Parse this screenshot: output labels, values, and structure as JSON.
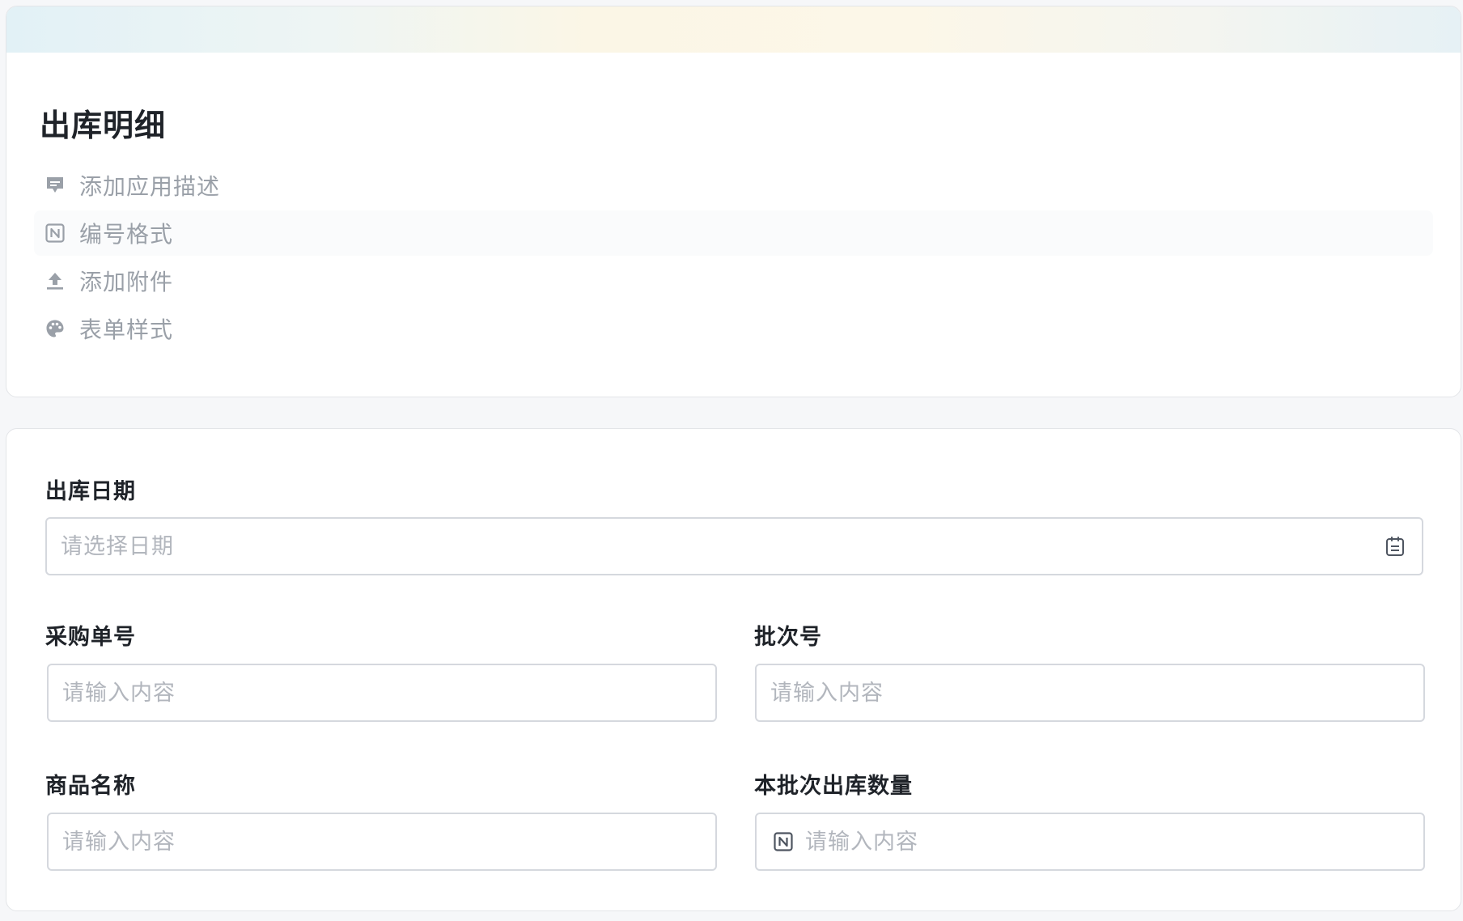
{
  "app": {
    "title": "出库明细",
    "meta": [
      {
        "label": "添加应用描述",
        "icon": "comment-icon"
      },
      {
        "label": "编号格式",
        "icon": "number-format-icon"
      },
      {
        "label": "添加附件",
        "icon": "upload-icon"
      },
      {
        "label": "表单样式",
        "icon": "palette-icon"
      }
    ]
  },
  "form": {
    "outbound_date": {
      "label": "出库日期",
      "placeholder": "请选择日期",
      "icon": "calendar-icon"
    },
    "purchase_no": {
      "label": "采购单号",
      "placeholder": "请输入内容"
    },
    "batch_no": {
      "label": "批次号",
      "placeholder": "请输入内容"
    },
    "product_name": {
      "label": "商品名称",
      "placeholder": "请输入内容"
    },
    "batch_quantity": {
      "label": "本批次出库数量",
      "placeholder": "请输入内容",
      "icon": "number-icon"
    }
  },
  "colors": {
    "icon_gray": "#9aa0a8",
    "text_primary": "#1f2329",
    "placeholder": "#b2b6bd",
    "border": "#d5d8de"
  }
}
